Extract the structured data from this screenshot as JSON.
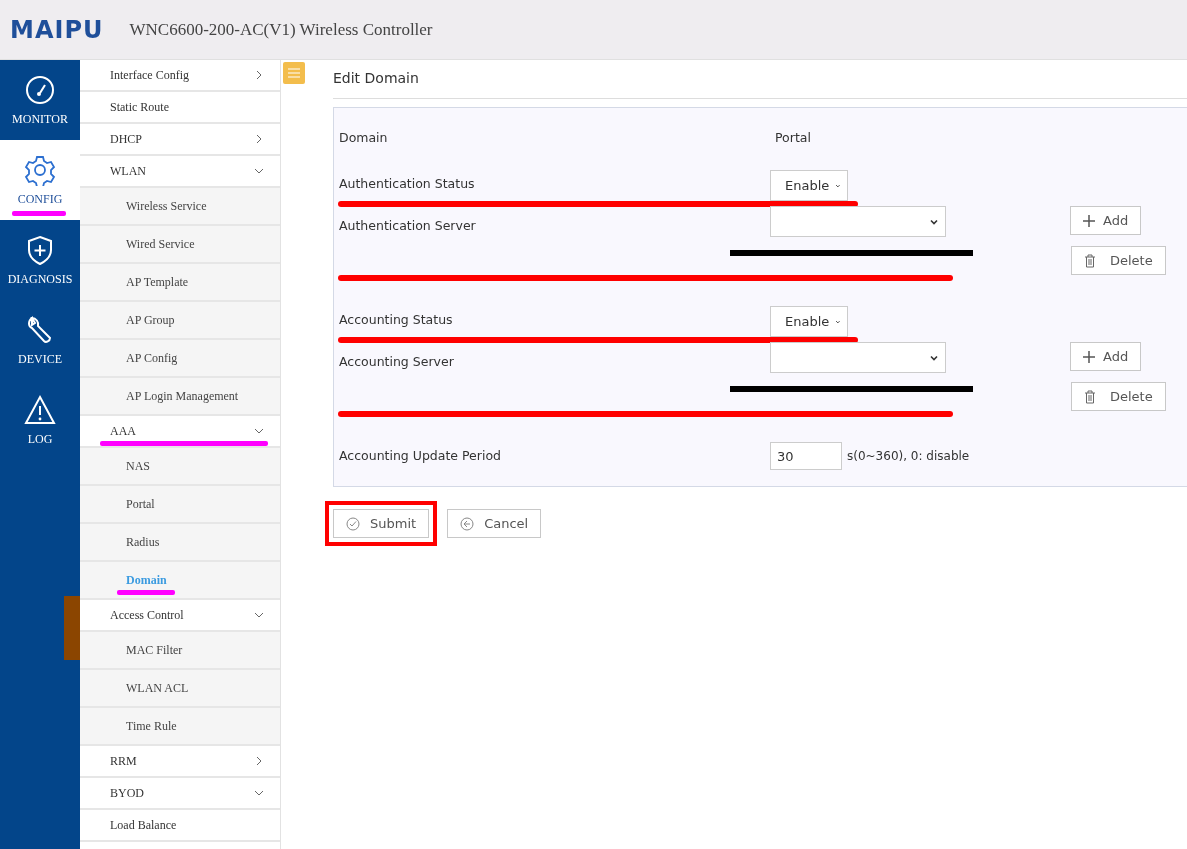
{
  "header": {
    "logo": "MAIPU",
    "title": "WNC6600-200-AC(V1) Wireless Controller"
  },
  "nav_rail": [
    {
      "label": "MONITOR",
      "selected": false
    },
    {
      "label": "CONFIG",
      "selected": true,
      "highlighted": true
    },
    {
      "label": "DIAGNOSIS",
      "selected": false
    },
    {
      "label": "DEVICE",
      "selected": false
    },
    {
      "label": "LOG",
      "selected": false
    }
  ],
  "menu": [
    {
      "label": "Interface Config",
      "expanded": false
    },
    {
      "label": "Static Route"
    },
    {
      "label": "DHCP",
      "expanded": false
    },
    {
      "label": "WLAN",
      "expanded": true,
      "children": [
        {
          "label": "Wireless Service",
          "selected": false
        },
        {
          "label": "Wired Service",
          "selected": false
        },
        {
          "label": "AP Template",
          "selected": false
        },
        {
          "label": "AP Group",
          "selected": false
        },
        {
          "label": "AP Config",
          "selected": false
        },
        {
          "label": "AP Login Management",
          "selected": false
        }
      ]
    },
    {
      "label": "AAA",
      "expanded": true,
      "highlighted": true,
      "children": [
        {
          "label": "NAS",
          "selected": false
        },
        {
          "label": "Portal",
          "selected": false
        },
        {
          "label": "Radius",
          "selected": false
        },
        {
          "label": "Domain",
          "selected": true,
          "highlighted": true
        }
      ]
    },
    {
      "label": "Access Control",
      "expanded": true,
      "children": [
        {
          "label": "MAC Filter",
          "selected": false
        },
        {
          "label": "WLAN ACL",
          "selected": false
        },
        {
          "label": "Time Rule",
          "selected": false
        }
      ]
    },
    {
      "label": "RRM",
      "expanded": false
    },
    {
      "label": "BYOD",
      "expanded": true
    },
    {
      "label": "Load Balance"
    }
  ],
  "page_title": "Edit Domain",
  "form": [
    {
      "kind": "text",
      "label": "Domain",
      "value": "Portal"
    },
    {
      "kind": "select",
      "label": "Authentication Status",
      "value": "Enable",
      "underlined": true
    },
    {
      "kind": "server",
      "label": "Authentication Server",
      "redacted": true,
      "underlined": true,
      "add": "Add",
      "delete": "Delete"
    },
    {
      "kind": "select",
      "label": "Accounting Status",
      "value": "Enable",
      "underlined": true
    },
    {
      "kind": "server",
      "label": "Accounting Server",
      "redacted": true,
      "underlined": true,
      "add": "Add",
      "delete": "Delete"
    },
    {
      "kind": "number",
      "label": "Accounting Update Period",
      "value": "30",
      "suffix": "s(0~360), 0: disable"
    }
  ],
  "actions": [
    {
      "label": "Submit",
      "outlined": true
    },
    {
      "label": "Cancel"
    }
  ]
}
